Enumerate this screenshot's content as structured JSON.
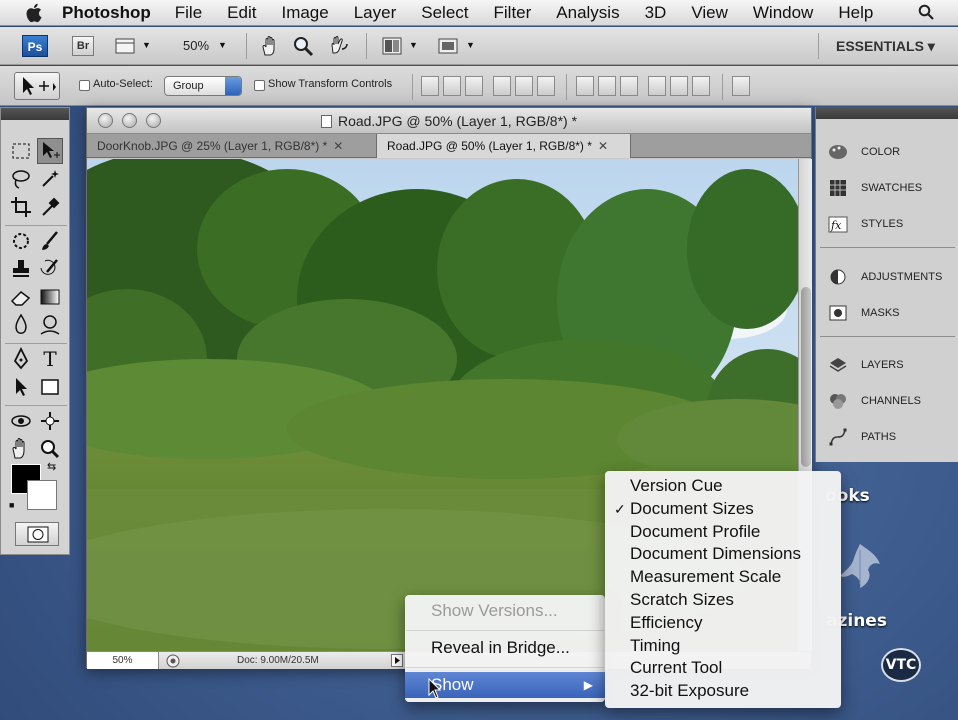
{
  "menubar": {
    "app": "Photoshop",
    "items": [
      "File",
      "Edit",
      "Image",
      "Layer",
      "Select",
      "Filter",
      "Analysis",
      "3D",
      "View",
      "Window",
      "Help"
    ]
  },
  "appbar": {
    "ps_badge": "Ps",
    "br_badge": "Br",
    "zoom": "50%",
    "workspace": "ESSENTIALS ▾"
  },
  "options": {
    "auto_select_label": "Auto-Select:",
    "auto_select_value": "Group",
    "show_transform_label": "Show Transform Controls"
  },
  "document": {
    "window_title": "Road.JPG @ 50% (Layer 1, RGB/8*) *",
    "tabs": [
      {
        "label": "DoorKnob.JPG @ 25% (Layer 1, RGB/8*) *",
        "close": "✕"
      },
      {
        "label": "Road.JPG @ 50% (Layer 1, RGB/8*) *",
        "close": "✕"
      }
    ],
    "status_zoom": "50%",
    "status_doc": "Doc: 9.00M/20.5M"
  },
  "panels": {
    "group1": [
      "COLOR",
      "SWATCHES",
      "STYLES"
    ],
    "group2": [
      "ADJUSTMENTS",
      "MASKS"
    ],
    "group3": [
      "LAYERS",
      "CHANNELS",
      "PATHS"
    ]
  },
  "context_menu": {
    "items": [
      {
        "label": "Show Versions...",
        "disabled": true
      },
      {
        "label": "Reveal in Bridge...",
        "disabled": false
      },
      {
        "label": "Show",
        "highlighted": true,
        "submenu": "▶"
      }
    ]
  },
  "show_submenu": {
    "checked_index": 1,
    "check_mark": "✓",
    "items": [
      "Version Cue",
      "Document Sizes",
      "Document Profile",
      "Document Dimensions",
      "Measurement Scale",
      "Scratch Sizes",
      "Efficiency",
      "Timing",
      "Current Tool",
      "32-bit Exposure"
    ]
  },
  "desktop": {
    "text1": "ooks",
    "text2": "azines",
    "logo": "VTC"
  }
}
